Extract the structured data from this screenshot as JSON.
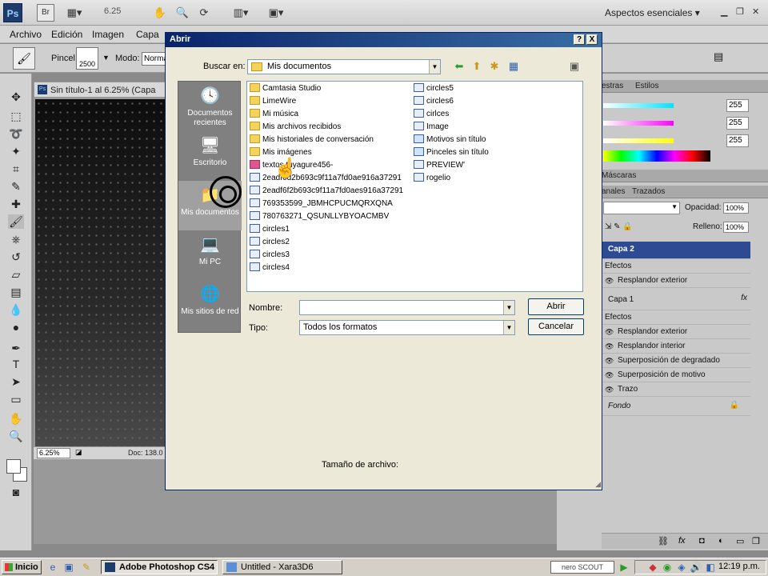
{
  "app": {
    "logo": "Ps",
    "bridge": "Br",
    "zoom": "6.25",
    "workspace": "Aspectos esenciales"
  },
  "menu": [
    "Archivo",
    "Edición",
    "Imagen",
    "Capa"
  ],
  "options": {
    "pincel_label": "Pincel:",
    "pincel_size": "2500",
    "modo_label": "Modo:",
    "modo_value": "Normal"
  },
  "document": {
    "tab_title": "Sin título-1 al 6.25% (Capa",
    "zoom": "6.25%",
    "doc_size": "Doc: 138.0"
  },
  "panels": {
    "tabs_top": [
      "estras",
      "Estilos"
    ],
    "slider_values": [
      "255",
      "255",
      "255"
    ],
    "slider_colors": [
      "#00e5ff",
      "#ff00ff",
      "#ffff00"
    ],
    "mascaras": "Máscaras",
    "tabs_layers": [
      "anales",
      "Trazados"
    ],
    "opacidad_label": "Opacidad:",
    "opacidad_value": "100%",
    "relleno_label": "Relleno:",
    "relleno_value": "100%",
    "layers": [
      {
        "name": "Capa 2",
        "active": true
      },
      {
        "name": "Efectos"
      },
      {
        "name": "Resplandor exterior"
      },
      {
        "name": "Capa 1"
      },
      {
        "name": "Efectos"
      },
      {
        "name": "Resplandor exterior"
      },
      {
        "name": "Resplandor interior"
      },
      {
        "name": "Superposición de degradado"
      },
      {
        "name": "Superposición de motivo"
      },
      {
        "name": "Trazo"
      },
      {
        "name": "Fondo"
      }
    ]
  },
  "dialog": {
    "title": "Abrir",
    "help": "?",
    "close": "X",
    "buscar_label": "Buscar en:",
    "buscar_value": "Mis documentos",
    "places": [
      {
        "label": "Documentos recientes",
        "icon": "clock-icon"
      },
      {
        "label": "Escritorio",
        "icon": "desktop-icon"
      },
      {
        "label": "Mis documentos",
        "icon": "folder-icon"
      },
      {
        "label": "Mi PC",
        "icon": "computer-icon"
      },
      {
        "label": "Mis sitios de red",
        "icon": "network-icon"
      }
    ],
    "files_col1": [
      {
        "name": "Camtasia Studio",
        "type": "folder"
      },
      {
        "name": "LimeWire",
        "type": "folder"
      },
      {
        "name": "Mi música",
        "type": "folder"
      },
      {
        "name": "Mis archivos recibidos",
        "type": "folder"
      },
      {
        "name": "Mis historiales de conversación",
        "type": "folder"
      },
      {
        "name": "Mis imágenes",
        "type": "folder"
      },
      {
        "name": "textos tuyagure456-",
        "type": "folder-pink"
      },
      {
        "name": "2eadf6d2b693c9f11a7fd0ae916a37291",
        "type": "img"
      },
      {
        "name": "2eadf6f2b693c9f11a7fd0aes916a37291",
        "type": "img"
      },
      {
        "name": "769353599_JBMHCPUCMQRXQNA",
        "type": "img"
      },
      {
        "name": "780763271_QSUNLLYBYOACMBV",
        "type": "img"
      },
      {
        "name": "circles1",
        "type": "img"
      },
      {
        "name": "circles2",
        "type": "img"
      },
      {
        "name": "circles3",
        "type": "img"
      },
      {
        "name": "circles4",
        "type": "img"
      }
    ],
    "files_col2": [
      {
        "name": "circles5",
        "type": "img"
      },
      {
        "name": "circles6",
        "type": "img"
      },
      {
        "name": "cirlces",
        "type": "img"
      },
      {
        "name": "Image",
        "type": "img"
      },
      {
        "name": "Motivos sin título",
        "type": "ps"
      },
      {
        "name": "Pinceles sin título",
        "type": "ps"
      },
      {
        "name": "PREVIEW'",
        "type": "img"
      },
      {
        "name": "rogelio",
        "type": "img"
      }
    ],
    "nombre_label": "Nombre:",
    "nombre_value": "",
    "tipo_label": "Tipo:",
    "tipo_value": "Todos los formatos",
    "open_button": "Abrir",
    "cancel_button": "Cancelar",
    "file_size_label": "Tamaño de archivo:"
  },
  "taskbar": {
    "start": "Inicio",
    "tasks": [
      "Adobe Photoshop CS4",
      "Untitled - Xara3D6"
    ],
    "nero": "nero SCOUT",
    "clock": "12:19 p.m."
  }
}
